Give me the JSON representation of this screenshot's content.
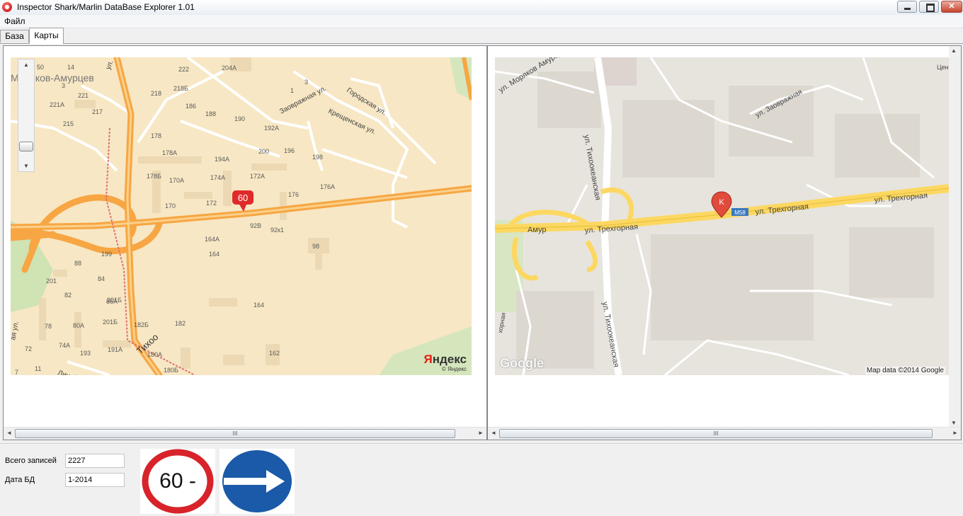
{
  "window": {
    "title": "Inspector Shark/Marlin DataBase Explorer 1.01"
  },
  "menu": {
    "file": "Файл"
  },
  "tabs": [
    "База",
    "Карты"
  ],
  "yandex_map": {
    "zoom_plus": "+",
    "zoom_minus": "−",
    "logo_ya": "Я",
    "logo_rest": "ндекс",
    "copyright": "© Яндекс",
    "marker_speed": "60",
    "street_labels": [
      "Моряков-Амурцев",
      "Заовражная ул.",
      "Городская ул.",
      "Крещенская ул.",
      "ул.",
      "Тихоо",
      "Линей",
      "ая ул."
    ],
    "building_numbers": [
      "50",
      "14",
      "3",
      "221",
      "221А",
      "217",
      "215",
      "222",
      "204А",
      "218",
      "218Б",
      "186",
      "188",
      "190",
      "192А",
      "178",
      "1",
      "3",
      "200",
      "196",
      "198",
      "178А",
      "194А",
      "178Б",
      "170А",
      "172А",
      "174А",
      "176",
      "176А",
      "170",
      "172",
      "92В",
      "92к1",
      "164А",
      "98",
      "164",
      "199",
      "88",
      "84",
      "201",
      "86А",
      "82",
      "201Б",
      "164",
      "78",
      "80А",
      "201Б",
      "182Б",
      "182",
      "74А",
      "72",
      "193",
      "191А",
      "180А",
      "162",
      "11",
      "180Б",
      "7"
    ]
  },
  "google_map": {
    "logo": "Google",
    "attribution": "Map data ©2014 Google",
    "marker": "K",
    "route_badge": "M58",
    "street_labels": [
      "ул. Моряков Амурцев",
      "ул. Заовражная",
      "ул. Тихоокеанская",
      "ул. Трехгорная",
      "ул. Трехгорная",
      "ул. Трехгорная",
      "Амур",
      "ул. Тихоокеанская",
      "хорная",
      "Цен"
    ]
  },
  "scroll": {
    "grip": "III",
    "left": "◄",
    "right": "►",
    "up": "▲",
    "down": "▼"
  },
  "stats": {
    "total_label": "Всего записей",
    "total_value": "2227",
    "date_label": "Дата БД",
    "date_value": "1-2014"
  },
  "signs": {
    "speed_text": "60 -"
  },
  "colors": {
    "titlebar": "#e9eef5",
    "yandex_bg": "#f7e7c4",
    "yandex_road": "#f7a643",
    "google_bg": "#e7e4de",
    "google_road": "#fcd862",
    "sign_red": "#d8232a",
    "sign_blue": "#1a5aa8"
  }
}
